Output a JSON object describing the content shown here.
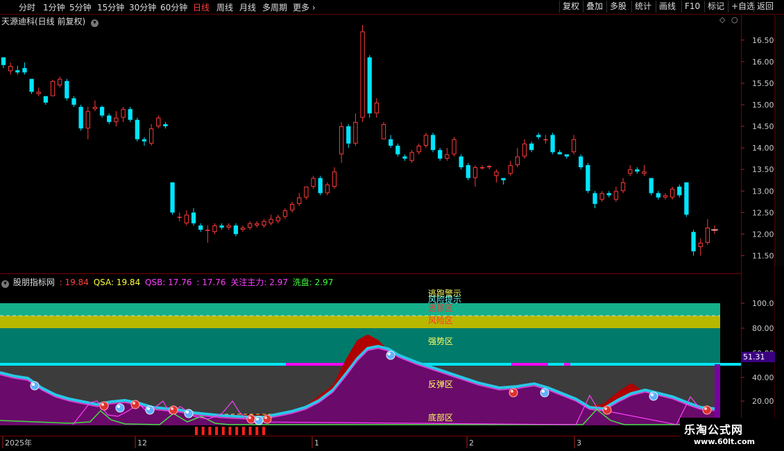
{
  "toolbar": {
    "tabs": [
      "分时",
      "1分钟",
      "5分钟",
      "15分钟",
      "30分钟",
      "60分钟",
      "日线",
      "周线",
      "月线",
      "多周期",
      "更多"
    ],
    "active_tab": "日线",
    "right_buttons": [
      "复权",
      "叠加",
      "多股",
      "统计",
      "画线",
      "F10",
      "标记",
      "+自选",
      "返回"
    ]
  },
  "price_panel": {
    "stock_title": "天源迪科(日线 前复权)",
    "y_ticks": [
      "16.50",
      "16.00",
      "15.50",
      "15.00",
      "14.50",
      "14.00",
      "13.50",
      "13.00",
      "12.50",
      "12.00",
      "11.50"
    ]
  },
  "indicator_panel": {
    "name": "股朋指标网",
    "values": [
      {
        "text": ": 19.84",
        "color": "#ff4040"
      },
      {
        "text": "QSA: 19.84",
        "color": "#ffff40"
      },
      {
        "text": "QSB: 17.76",
        "color": "#ff40ff"
      },
      {
        "text": ": 17.76",
        "color": "#ff40ff"
      },
      {
        "text": "关注主力: 2.97",
        "color": "#ff40ff"
      },
      {
        "text": "洗盘: 2.97",
        "color": "#40ff40"
      }
    ],
    "zones": {
      "escape_warning": "逃跑警示",
      "risk_hint": "风险提示",
      "top_zone": "逃顶区",
      "risk_zone": "风险区",
      "strong_zone": "强势区",
      "rebound_zone": "反弹区",
      "bottom_zone": "底部区"
    },
    "y_ticks": [
      "100.0",
      "80.00",
      "60.00",
      "40.00",
      "20.00"
    ],
    "current_value": "51.31"
  },
  "date_axis": [
    "2025年",
    "12",
    "1",
    "2",
    "3"
  ],
  "watermark": {
    "line1": "乐淘公式网",
    "line2": "www.60lt.com"
  },
  "colors": {
    "up": "#ff3b3b",
    "down": "#00e5ff",
    "purple": "#6a0a6a",
    "teal": "#007a6a",
    "bright_teal": "#15b08a",
    "yellow_band": "#b8b800"
  },
  "chart_data": {
    "type": "candlestick",
    "ylim": [
      11.25,
      16.85
    ],
    "candles": [
      [
        16.1,
        15.92,
        16.1,
        15.85
      ],
      [
        15.78,
        15.9,
        15.98,
        15.7
      ],
      [
        15.8,
        15.75,
        15.9,
        15.7
      ],
      [
        15.85,
        15.75,
        15.98,
        15.7
      ],
      [
        15.6,
        15.3,
        15.6,
        15.25
      ],
      [
        15.25,
        15.3,
        15.4,
        15.2
      ],
      [
        15.2,
        15.05,
        15.2,
        15.0
      ],
      [
        15.2,
        15.55,
        15.58,
        15.2
      ],
      [
        15.45,
        15.6,
        15.65,
        15.4
      ],
      [
        15.55,
        15.15,
        15.6,
        15.1
      ],
      [
        15.15,
        15.0,
        15.2,
        14.95
      ],
      [
        14.95,
        14.45,
        15.0,
        14.4
      ],
      [
        14.45,
        14.85,
        14.95,
        14.2
      ],
      [
        14.9,
        14.95,
        15.1,
        14.85
      ],
      [
        14.95,
        14.75,
        14.98,
        14.7
      ],
      [
        14.75,
        14.6,
        14.8,
        14.55
      ],
      [
        14.6,
        14.7,
        14.85,
        14.5
      ],
      [
        14.7,
        14.9,
        14.95,
        14.6
      ],
      [
        14.9,
        14.65,
        14.95,
        14.6
      ],
      [
        14.65,
        14.2,
        14.7,
        14.15
      ],
      [
        14.2,
        14.15,
        14.25,
        14.05
      ],
      [
        14.1,
        14.45,
        14.55,
        14.05
      ],
      [
        14.5,
        14.7,
        14.75,
        14.45
      ],
      [
        14.55,
        14.5,
        14.6,
        14.45
      ],
      [
        13.2,
        12.5,
        13.2,
        12.45
      ],
      [
        12.4,
        12.4,
        12.5,
        12.3
      ],
      [
        12.25,
        12.45,
        12.55,
        12.2
      ],
      [
        12.5,
        12.25,
        12.6,
        12.2
      ],
      [
        12.2,
        12.1,
        12.25,
        12.05
      ],
      [
        12.1,
        12.1,
        12.2,
        11.8
      ],
      [
        12.05,
        12.2,
        12.25,
        12.0
      ],
      [
        12.2,
        12.15,
        12.25,
        12.1
      ],
      [
        12.15,
        12.2,
        12.25,
        12.1
      ],
      [
        12.2,
        12.0,
        12.25,
        11.95
      ],
      [
        12.1,
        12.15,
        12.2,
        12.05
      ],
      [
        12.15,
        12.25,
        12.3,
        12.1
      ],
      [
        12.2,
        12.25,
        12.3,
        12.15
      ],
      [
        12.2,
        12.3,
        12.35,
        12.15
      ],
      [
        12.25,
        12.35,
        12.45,
        12.2
      ],
      [
        12.3,
        12.4,
        12.45,
        12.25
      ],
      [
        12.4,
        12.55,
        12.6,
        12.35
      ],
      [
        12.55,
        12.7,
        12.75,
        12.5
      ],
      [
        12.7,
        12.85,
        12.95,
        12.65
      ],
      [
        12.85,
        13.1,
        13.1,
        12.8
      ],
      [
        13.1,
        13.3,
        13.35,
        13.05
      ],
      [
        13.3,
        12.95,
        13.35,
        12.9
      ],
      [
        12.95,
        13.15,
        13.2,
        12.9
      ],
      [
        13.1,
        13.45,
        13.55,
        13.05
      ],
      [
        13.85,
        14.5,
        14.6,
        13.65
      ],
      [
        14.5,
        14.1,
        14.55,
        14.0
      ],
      [
        14.1,
        14.6,
        14.8,
        14.05
      ],
      [
        14.7,
        16.7,
        16.85,
        14.6
      ],
      [
        16.1,
        14.8,
        16.15,
        14.7
      ],
      [
        14.8,
        15.05,
        15.15,
        14.7
      ],
      [
        14.2,
        14.55,
        14.6,
        14.2
      ],
      [
        14.2,
        14.05,
        14.3,
        14.0
      ],
      [
        14.05,
        13.85,
        14.1,
        13.8
      ],
      [
        13.8,
        13.75,
        13.85,
        13.7
      ],
      [
        13.7,
        13.9,
        13.95,
        13.65
      ],
      [
        13.9,
        14.05,
        14.1,
        13.85
      ],
      [
        14.05,
        14.3,
        14.35,
        14.0
      ],
      [
        14.3,
        13.95,
        14.35,
        13.9
      ],
      [
        13.95,
        13.75,
        14.0,
        13.7
      ],
      [
        13.75,
        13.85,
        14.0,
        13.7
      ],
      [
        13.85,
        14.2,
        14.25,
        13.8
      ],
      [
        13.8,
        13.55,
        13.85,
        13.5
      ],
      [
        13.6,
        13.3,
        13.65,
        13.25
      ],
      [
        13.3,
        13.55,
        13.6,
        13.1
      ],
      [
        13.55,
        13.55,
        13.6,
        13.5
      ],
      [
        13.55,
        13.58,
        13.6,
        13.5
      ],
      [
        13.35,
        13.45,
        13.5,
        13.2
      ],
      [
        13.3,
        13.25,
        13.3,
        13.15
      ],
      [
        13.4,
        13.6,
        13.7,
        13.35
      ],
      [
        13.6,
        13.8,
        14.0,
        13.55
      ],
      [
        13.8,
        14.1,
        14.2,
        13.75
      ],
      [
        14.1,
        13.95,
        14.15,
        13.9
      ],
      [
        14.3,
        14.25,
        14.35,
        14.2
      ],
      [
        14.2,
        14.2,
        14.3,
        14.1
      ],
      [
        14.3,
        13.9,
        14.35,
        13.85
      ],
      [
        13.9,
        13.85,
        13.95,
        13.85
      ],
      [
        13.85,
        13.8,
        13.85,
        13.75
      ],
      [
        13.9,
        14.2,
        14.3,
        13.85
      ],
      [
        13.8,
        13.55,
        13.85,
        13.5
      ],
      [
        13.6,
        13.0,
        13.65,
        12.95
      ],
      [
        12.95,
        12.7,
        13.0,
        12.6
      ],
      [
        12.8,
        12.95,
        13.0,
        12.75
      ],
      [
        12.95,
        12.9,
        13.0,
        12.85
      ],
      [
        12.8,
        13.0,
        13.1,
        12.75
      ],
      [
        13.0,
        13.2,
        13.3,
        12.95
      ],
      [
        13.4,
        13.5,
        13.6,
        13.35
      ],
      [
        13.5,
        13.45,
        13.55,
        13.4
      ],
      [
        13.4,
        13.45,
        13.6,
        13.35
      ],
      [
        13.3,
        12.95,
        13.3,
        12.9
      ],
      [
        12.95,
        12.85,
        13.0,
        12.8
      ],
      [
        12.85,
        12.9,
        12.95,
        12.8
      ],
      [
        12.85,
        13.05,
        13.1,
        12.8
      ],
      [
        13.1,
        12.9,
        13.15,
        12.85
      ],
      [
        13.2,
        12.45,
        13.2,
        12.4
      ],
      [
        12.05,
        11.6,
        12.1,
        11.5
      ],
      [
        11.7,
        11.8,
        11.9,
        11.5
      ],
      [
        11.8,
        12.15,
        12.35,
        11.75
      ],
      [
        12.1,
        12.1,
        12.2,
        12.0
      ]
    ]
  }
}
